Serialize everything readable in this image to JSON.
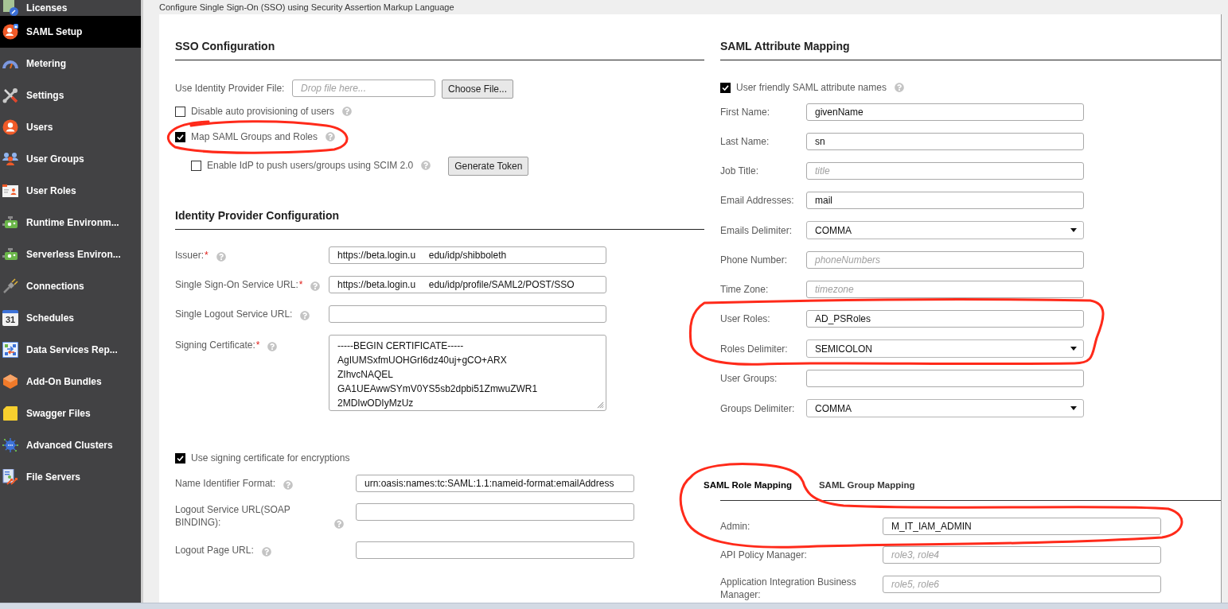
{
  "header": {
    "subtitle": "Configure Single Sign-On (SSO) using Security Assertion Markup Language"
  },
  "sidebar": {
    "items": [
      {
        "label": "Licenses",
        "selected": false
      },
      {
        "label": "SAML Setup",
        "selected": true
      },
      {
        "label": "Metering",
        "selected": false
      },
      {
        "label": "Settings",
        "selected": false
      },
      {
        "label": "Users",
        "selected": false
      },
      {
        "label": "User Groups",
        "selected": false
      },
      {
        "label": "User Roles",
        "selected": false
      },
      {
        "label": "Runtime Environm...",
        "selected": false
      },
      {
        "label": "Serverless Environ...",
        "selected": false
      },
      {
        "label": "Connections",
        "selected": false
      },
      {
        "label": "Schedules",
        "selected": false,
        "icon_text": "31"
      },
      {
        "label": "Data Services Rep...",
        "selected": false
      },
      {
        "label": "Add-On Bundles",
        "selected": false
      },
      {
        "label": "Swagger Files",
        "selected": false
      },
      {
        "label": "Advanced Clusters",
        "selected": false
      },
      {
        "label": "File Servers",
        "selected": false
      }
    ]
  },
  "sso_configuration": {
    "title": "SSO Configuration",
    "identity_provider_file": {
      "label": "Use Identity Provider File:",
      "placeholder": "Drop file here...",
      "button": "Choose File..."
    },
    "options": [
      {
        "label": "Disable auto provisioning of users",
        "checked": false,
        "help": true
      },
      {
        "label": "Map SAML Groups and Roles",
        "checked": true,
        "help": true,
        "children": [
          {
            "label": "Enable IdP to push users/groups using SCIM 2.0",
            "checked": false,
            "help": true,
            "button": "Generate Token"
          }
        ]
      }
    ]
  },
  "identity_provider_configuration": {
    "title": "Identity Provider Configuration",
    "fields": [
      {
        "label": "Issuer:",
        "required_mark": "*",
        "help": true,
        "kind": "text",
        "value": "https://beta.login.u     edu/idp/shibboleth"
      },
      {
        "label": "Single Sign-On Service URL:",
        "required_mark": "*",
        "help": true,
        "kind": "text",
        "value": "https://beta.login.u     edu/idp/profile/SAML2/POST/SSO"
      },
      {
        "label": "Single Logout Service URL:",
        "help": true,
        "kind": "text"
      },
      {
        "label": "Signing Certificate:",
        "required_mark": "*",
        "help": true,
        "kind": "textarea",
        "lines": [
          "-----BEGIN CERTIFICATE-----",
          "AgIUMSxfmUOHGrI6dz40uj+gCO+ARX",
          "ZIhvcNAQEL",
          "GA1UEAwwSYmV0YS5sb2dpbi51ZmwuZWR1",
          "2MDIwODIyMzUz"
        ]
      }
    ]
  },
  "encryption": {
    "option": {
      "label": "Use signing certificate for encryptions",
      "checked": true
    },
    "fields": [
      {
        "label": "Name Identifier Format:",
        "help": true,
        "kind": "text",
        "value": "urn:oasis:names:tc:SAML:1.1:nameid-format:emailAddress"
      },
      {
        "label": "Logout Service URL(SOAP BINDING):",
        "help": true,
        "kind": "text"
      },
      {
        "label": "Logout Page URL:",
        "help": true,
        "kind": "text"
      }
    ]
  },
  "saml_attribute_mapping": {
    "title": "SAML Attribute Mapping",
    "option": {
      "label": "User friendly SAML attribute names",
      "checked": true,
      "help": true
    },
    "fields": [
      {
        "label": "First Name:",
        "kind": "text",
        "value": "givenName"
      },
      {
        "label": "Last Name:",
        "kind": "text",
        "value": "sn"
      },
      {
        "label": "Job Title:",
        "kind": "text",
        "placeholder": "title"
      },
      {
        "label": "Email Addresses:",
        "kind": "text",
        "value": "mail"
      },
      {
        "label": "Emails Delimiter:",
        "kind": "select",
        "value": "COMMA"
      },
      {
        "label": "Phone Number:",
        "kind": "text",
        "placeholder": "phoneNumbers"
      },
      {
        "label": "Time Zone:",
        "kind": "text",
        "placeholder": "timezone"
      },
      {
        "label": "User Roles:",
        "kind": "text",
        "value": "AD_PSRoles"
      },
      {
        "label": "Roles Delimiter:",
        "kind": "select",
        "value": "SEMICOLON"
      },
      {
        "label": "User Groups:",
        "kind": "text"
      },
      {
        "label": "Groups Delimiter:",
        "kind": "select",
        "value": "COMMA"
      }
    ]
  },
  "role_mapping": {
    "tabs": [
      {
        "label": "SAML Role Mapping",
        "selected": true
      },
      {
        "label": "SAML Group Mapping",
        "selected": false
      }
    ],
    "fields": [
      {
        "label": "Admin:",
        "kind": "text",
        "value": "M_IT_IAM_ADMIN"
      },
      {
        "label": "API Policy Manager:",
        "kind": "text",
        "placeholder": "role3, role4"
      },
      {
        "label": "Application Integration Business Manager:",
        "kind": "text",
        "placeholder": "role5, role6"
      }
    ]
  }
}
